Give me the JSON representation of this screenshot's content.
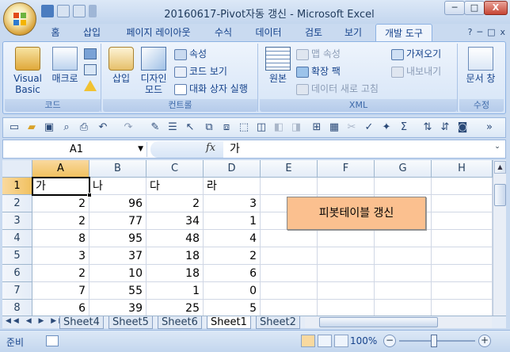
{
  "window": {
    "title": "20160617-Pivot자동 갱신 - Microsoft Excel",
    "min_label": "─",
    "max_label": "□",
    "close_label": "X"
  },
  "tabs": [
    {
      "label": "홈"
    },
    {
      "label": "삽입"
    },
    {
      "label": "페이지 레이아웃"
    },
    {
      "label": "수식"
    },
    {
      "label": "데이터"
    },
    {
      "label": "검토"
    },
    {
      "label": "보기"
    },
    {
      "label": "개발 도구",
      "active": true
    }
  ],
  "ribbon": {
    "code_group": {
      "label": "코드",
      "visual_basic": "Visual Basic",
      "macro": "매크로"
    },
    "controls_group": {
      "label": "컨트롤",
      "insert": "삽입",
      "design_mode": "디자인 모드",
      "properties": "속성",
      "view_code": "코드 보기",
      "dialog": "대화 상자 실행"
    },
    "xml_group": {
      "label": "XML",
      "source": "원본",
      "map_properties": "맵 속성",
      "expansion_packs": "확장 팩",
      "refresh_data": "데이터 새로 고침",
      "import": "가져오기",
      "export": "내보내기"
    },
    "modify_group": {
      "label": "수정",
      "document_panel": "문서 창"
    }
  },
  "formula_bar": {
    "name_box": "A1",
    "fx": "fx",
    "value": "가"
  },
  "sheet": {
    "columns": [
      "A",
      "B",
      "C",
      "D",
      "E",
      "F",
      "G",
      "H"
    ],
    "selected_column": "A",
    "selected_row": "1",
    "rows": [
      {
        "n": "1",
        "cells": [
          "가",
          "나",
          "다",
          "라"
        ],
        "header": true
      },
      {
        "n": "2",
        "cells": [
          "2",
          "96",
          "2",
          "3"
        ]
      },
      {
        "n": "3",
        "cells": [
          "2",
          "77",
          "34",
          "1"
        ]
      },
      {
        "n": "4",
        "cells": [
          "8",
          "95",
          "48",
          "4"
        ]
      },
      {
        "n": "5",
        "cells": [
          "3",
          "37",
          "18",
          "2"
        ]
      },
      {
        "n": "6",
        "cells": [
          "2",
          "10",
          "18",
          "6"
        ]
      },
      {
        "n": "7",
        "cells": [
          "7",
          "55",
          "1",
          "0"
        ]
      },
      {
        "n": "8",
        "cells": [
          "6",
          "39",
          "25",
          "5"
        ]
      }
    ],
    "pivot_button": "피봇테이블 갱신"
  },
  "sheet_tabs": [
    {
      "label": "Sheet4"
    },
    {
      "label": "Sheet5"
    },
    {
      "label": "Sheet6"
    },
    {
      "label": "Sheet1",
      "active": true
    },
    {
      "label": "Sheet2"
    }
  ],
  "status": {
    "ready": "준비",
    "zoom": "100%",
    "zoom_minus": "−",
    "zoom_plus": "+"
  },
  "colors": {
    "accent": "#15428b",
    "ribbon_bg": "#d5e4f7",
    "pivot_button": "#fbc08f",
    "selection_header": "#f1c15f"
  }
}
